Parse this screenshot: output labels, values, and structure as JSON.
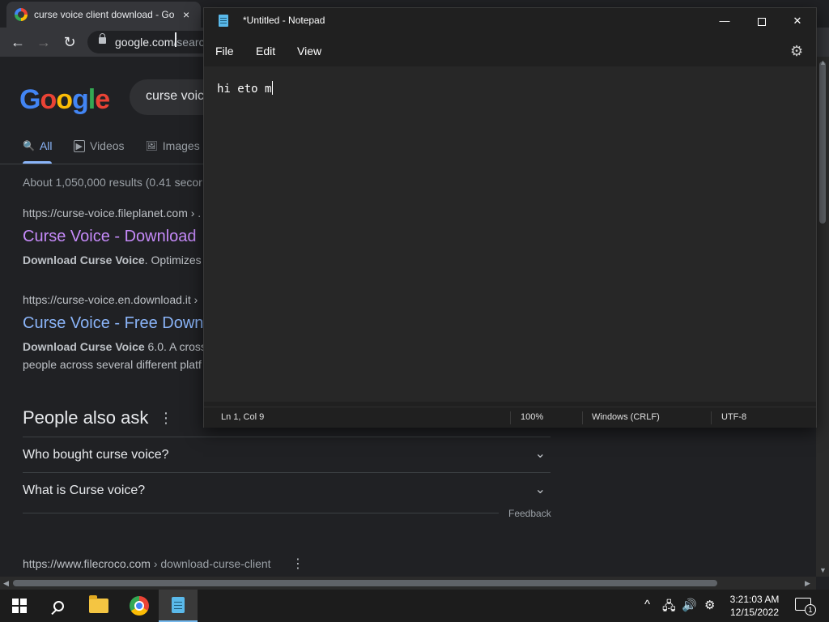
{
  "browser": {
    "tab_title": "curse voice client download - Go",
    "tab_close": "×",
    "url_host": "google.com",
    "url_rest": "/search",
    "back": "←",
    "forward": "→",
    "reload": "↻"
  },
  "google": {
    "logo": [
      "G",
      "o",
      "o",
      "g",
      "l",
      "e"
    ],
    "logo_colors": [
      "#4285f4",
      "#ea4335",
      "#fbbc05",
      "#4285f4",
      "#34a853",
      "#ea4335"
    ],
    "query": "curse voic",
    "tabs": [
      {
        "icon": "🔍",
        "label": "All"
      },
      {
        "icon": "▶",
        "label": "Videos"
      },
      {
        "icon": "🖼",
        "label": "Images"
      }
    ],
    "stats": "About 1,050,000 results (0.41 secor",
    "results": [
      {
        "cite": "https://curse-voice.fileplanet.com › .",
        "title": "Curse Voice - Download",
        "title_color": "#c58af9",
        "snippet_bold": "Download Curse Voice",
        "snippet_rest": ". Optimizes s"
      },
      {
        "cite": "https://curse-voice.en.download.it ›",
        "title": "Curse Voice - Free Downl",
        "title_color": "#8ab4f8",
        "snippet_bold": "Download Curse Voice",
        "snippet_rest": " 6.0. A cross-",
        "snippet_line2": "people across several different platf"
      }
    ],
    "paa_title": "People also ask",
    "paa_dots": "⋮",
    "paa_questions": [
      "Who bought curse voice?",
      "What is Curse voice?"
    ],
    "chevron": "⌄",
    "feedback": "Feedback",
    "result3_host": "https://www.filecroco.com",
    "result3_path": " › download-curse-client",
    "result3_dots": "⋮"
  },
  "notepad": {
    "title": "*Untitled - Notepad",
    "minimize": "—",
    "close": "✕",
    "menu": [
      "File",
      "Edit",
      "View"
    ],
    "settings_glyph": "⚙",
    "content": "hi eto m",
    "status": {
      "position": "Ln 1, Col 9",
      "zoom": "100%",
      "line_ending": "Windows (CRLF)",
      "encoding": "UTF-8"
    }
  },
  "taskbar": {
    "search_glyph": "⌕",
    "tray_chevron": "^",
    "network_glyph": "🖧",
    "volume_glyph": "🔊",
    "settings_glyph": "⚙",
    "time": "3:21:03 AM",
    "date": "12/15/2022",
    "notifications": "1"
  }
}
